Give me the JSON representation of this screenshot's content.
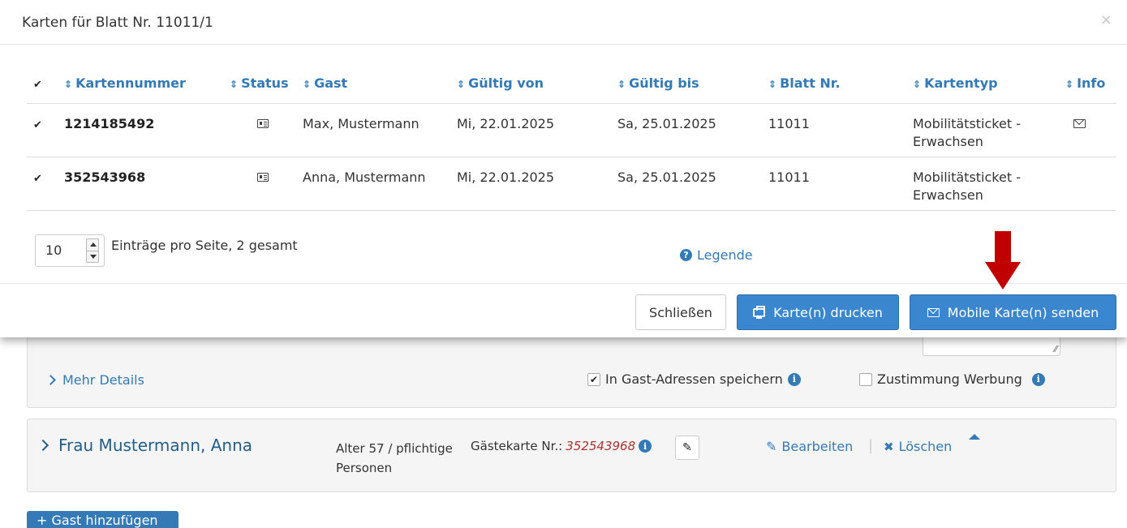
{
  "modal": {
    "title": "Karten für Blatt Nr. 11011/1",
    "close_glyph": "×",
    "table": {
      "columns": [
        "Kartennummer",
        "Status",
        "Gast",
        "Gültig von",
        "Gültig bis",
        "Blatt Nr.",
        "Kartentyp",
        "Info"
      ],
      "rows": [
        {
          "card_number": "1214185492",
          "guest": "Max, Mustermann",
          "valid_from": "Mi, 22.01.2025",
          "valid_to": "Sa, 25.01.2025",
          "sheet_no": "11011",
          "card_type_line1": "Mobilitätsticket -",
          "card_type_line2": "Erwachsen",
          "has_info_icon": true,
          "checked": true
        },
        {
          "card_number": "352543968",
          "guest": "Anna, Mustermann",
          "valid_from": "Mi, 22.01.2025",
          "valid_to": "Sa, 25.01.2025",
          "sheet_no": "11011",
          "card_type_line1": "Mobilitätsticket -",
          "card_type_line2": "Erwachsen",
          "has_info_icon": false,
          "checked": true
        }
      ]
    },
    "pager": {
      "page_size": "10",
      "summary": "Einträge pro Seite, 2 gesamt"
    },
    "legend_label": "Legende",
    "footer": {
      "close_label": "Schließen",
      "print_label": "Karte(n) drucken",
      "send_label": "Mobile Karte(n) senden"
    }
  },
  "background": {
    "more_details_label": "Mehr Details",
    "save_in_addresses_label": "In Gast-Adressen speichern",
    "save_in_addresses_checked": true,
    "consent_ads_label": "Zustimmung Werbung",
    "consent_ads_checked": false,
    "guest": {
      "name": "Frau Mustermann, Anna",
      "age_line": "Alter 57 / pflichtige Personen",
      "guest_card_label": "Gästekarte Nr.:",
      "guest_card_number": "352543968",
      "edit_label": "Bearbeiten",
      "delete_label": "Löschen"
    },
    "add_guest_label": "+ Gast hinzufügen"
  },
  "colors": {
    "link_blue": "#337ab7",
    "button_blue": "#3a86cf",
    "arrow_red": "#c00000",
    "card_number_red": "#b03030"
  },
  "icons": {
    "status": "id-card-icon",
    "info": "envelope-icon",
    "print": "printer-icon",
    "send": "envelope-icon",
    "legend": "question-circle-icon",
    "edit": "pencil-icon",
    "delete": "x-icon"
  }
}
